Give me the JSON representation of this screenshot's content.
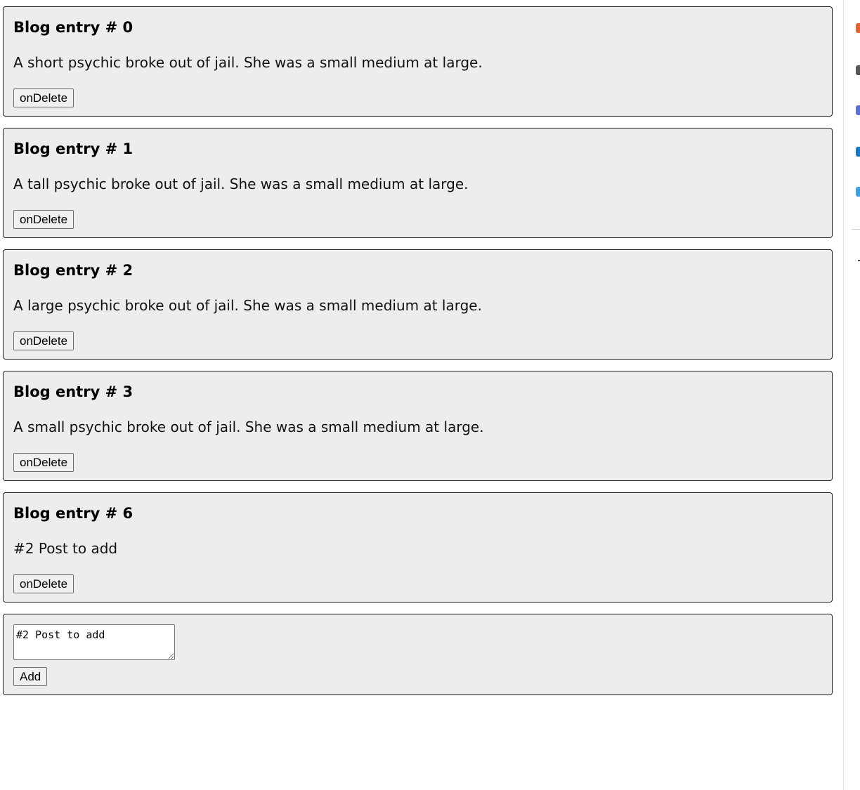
{
  "entries": [
    {
      "title": "Blog entry # 0",
      "text": "A short psychic broke out of jail. She was a small medium at large.",
      "button": "onDelete"
    },
    {
      "title": "Blog entry # 1",
      "text": "A tall psychic broke out of jail. She was a small medium at large.",
      "button": "onDelete"
    },
    {
      "title": "Blog entry # 2",
      "text": "A large psychic broke out of jail. She was a small medium at large.",
      "button": "onDelete"
    },
    {
      "title": "Blog entry # 3",
      "text": "A small psychic broke out of jail. She was a small medium at large.",
      "button": "onDelete"
    },
    {
      "title": "Blog entry # 6",
      "text": "#2 Post to add",
      "button": "onDelete"
    }
  ],
  "composer": {
    "input_value": "#2 Post to add",
    "add_label": "Add"
  },
  "side_panel": {
    "icons": [
      {
        "name": "extension-icon-orange",
        "color": "#e8622c"
      },
      {
        "name": "extension-icon-person",
        "color": "#555555"
      },
      {
        "name": "extension-icon-purple",
        "color": "#5b6fd6"
      },
      {
        "name": "extension-icon-blue",
        "color": "#1679c4"
      },
      {
        "name": "extension-icon-lightblue",
        "color": "#3aa0e0"
      }
    ]
  }
}
